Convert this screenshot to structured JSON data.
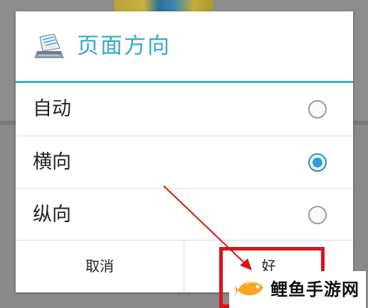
{
  "dialog": {
    "title": "页面方向",
    "icon": "printer-paper-icon",
    "options": [
      {
        "label": "自动",
        "checked": false
      },
      {
        "label": "横向",
        "checked": true
      },
      {
        "label": "纵向",
        "checked": false
      }
    ],
    "buttons": {
      "cancel_label": "取消",
      "ok_label": "好"
    }
  },
  "watermark": {
    "text": "鲤鱼手游网",
    "logo": "carp-fish-logo"
  },
  "colors": {
    "accent": "#41aed0",
    "title_text": "#3aa9c7",
    "radio_selected": "#2c9fd6",
    "annotation_red": "#d8141a"
  }
}
